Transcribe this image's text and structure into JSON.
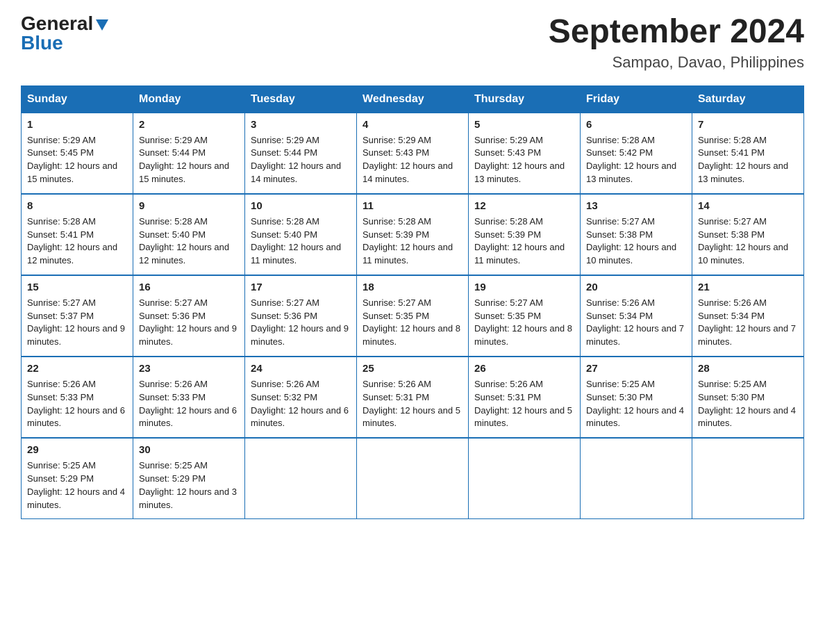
{
  "header": {
    "logo_general": "General",
    "logo_blue": "Blue",
    "month_year": "September 2024",
    "location": "Sampao, Davao, Philippines"
  },
  "days_of_week": [
    "Sunday",
    "Monday",
    "Tuesday",
    "Wednesday",
    "Thursday",
    "Friday",
    "Saturday"
  ],
  "weeks": [
    [
      {
        "day": "1",
        "sunrise": "Sunrise: 5:29 AM",
        "sunset": "Sunset: 5:45 PM",
        "daylight": "Daylight: 12 hours and 15 minutes."
      },
      {
        "day": "2",
        "sunrise": "Sunrise: 5:29 AM",
        "sunset": "Sunset: 5:44 PM",
        "daylight": "Daylight: 12 hours and 15 minutes."
      },
      {
        "day": "3",
        "sunrise": "Sunrise: 5:29 AM",
        "sunset": "Sunset: 5:44 PM",
        "daylight": "Daylight: 12 hours and 14 minutes."
      },
      {
        "day": "4",
        "sunrise": "Sunrise: 5:29 AM",
        "sunset": "Sunset: 5:43 PM",
        "daylight": "Daylight: 12 hours and 14 minutes."
      },
      {
        "day": "5",
        "sunrise": "Sunrise: 5:29 AM",
        "sunset": "Sunset: 5:43 PM",
        "daylight": "Daylight: 12 hours and 13 minutes."
      },
      {
        "day": "6",
        "sunrise": "Sunrise: 5:28 AM",
        "sunset": "Sunset: 5:42 PM",
        "daylight": "Daylight: 12 hours and 13 minutes."
      },
      {
        "day": "7",
        "sunrise": "Sunrise: 5:28 AM",
        "sunset": "Sunset: 5:41 PM",
        "daylight": "Daylight: 12 hours and 13 minutes."
      }
    ],
    [
      {
        "day": "8",
        "sunrise": "Sunrise: 5:28 AM",
        "sunset": "Sunset: 5:41 PM",
        "daylight": "Daylight: 12 hours and 12 minutes."
      },
      {
        "day": "9",
        "sunrise": "Sunrise: 5:28 AM",
        "sunset": "Sunset: 5:40 PM",
        "daylight": "Daylight: 12 hours and 12 minutes."
      },
      {
        "day": "10",
        "sunrise": "Sunrise: 5:28 AM",
        "sunset": "Sunset: 5:40 PM",
        "daylight": "Daylight: 12 hours and 11 minutes."
      },
      {
        "day": "11",
        "sunrise": "Sunrise: 5:28 AM",
        "sunset": "Sunset: 5:39 PM",
        "daylight": "Daylight: 12 hours and 11 minutes."
      },
      {
        "day": "12",
        "sunrise": "Sunrise: 5:28 AM",
        "sunset": "Sunset: 5:39 PM",
        "daylight": "Daylight: 12 hours and 11 minutes."
      },
      {
        "day": "13",
        "sunrise": "Sunrise: 5:27 AM",
        "sunset": "Sunset: 5:38 PM",
        "daylight": "Daylight: 12 hours and 10 minutes."
      },
      {
        "day": "14",
        "sunrise": "Sunrise: 5:27 AM",
        "sunset": "Sunset: 5:38 PM",
        "daylight": "Daylight: 12 hours and 10 minutes."
      }
    ],
    [
      {
        "day": "15",
        "sunrise": "Sunrise: 5:27 AM",
        "sunset": "Sunset: 5:37 PM",
        "daylight": "Daylight: 12 hours and 9 minutes."
      },
      {
        "day": "16",
        "sunrise": "Sunrise: 5:27 AM",
        "sunset": "Sunset: 5:36 PM",
        "daylight": "Daylight: 12 hours and 9 minutes."
      },
      {
        "day": "17",
        "sunrise": "Sunrise: 5:27 AM",
        "sunset": "Sunset: 5:36 PM",
        "daylight": "Daylight: 12 hours and 9 minutes."
      },
      {
        "day": "18",
        "sunrise": "Sunrise: 5:27 AM",
        "sunset": "Sunset: 5:35 PM",
        "daylight": "Daylight: 12 hours and 8 minutes."
      },
      {
        "day": "19",
        "sunrise": "Sunrise: 5:27 AM",
        "sunset": "Sunset: 5:35 PM",
        "daylight": "Daylight: 12 hours and 8 minutes."
      },
      {
        "day": "20",
        "sunrise": "Sunrise: 5:26 AM",
        "sunset": "Sunset: 5:34 PM",
        "daylight": "Daylight: 12 hours and 7 minutes."
      },
      {
        "day": "21",
        "sunrise": "Sunrise: 5:26 AM",
        "sunset": "Sunset: 5:34 PM",
        "daylight": "Daylight: 12 hours and 7 minutes."
      }
    ],
    [
      {
        "day": "22",
        "sunrise": "Sunrise: 5:26 AM",
        "sunset": "Sunset: 5:33 PM",
        "daylight": "Daylight: 12 hours and 6 minutes."
      },
      {
        "day": "23",
        "sunrise": "Sunrise: 5:26 AM",
        "sunset": "Sunset: 5:33 PM",
        "daylight": "Daylight: 12 hours and 6 minutes."
      },
      {
        "day": "24",
        "sunrise": "Sunrise: 5:26 AM",
        "sunset": "Sunset: 5:32 PM",
        "daylight": "Daylight: 12 hours and 6 minutes."
      },
      {
        "day": "25",
        "sunrise": "Sunrise: 5:26 AM",
        "sunset": "Sunset: 5:31 PM",
        "daylight": "Daylight: 12 hours and 5 minutes."
      },
      {
        "day": "26",
        "sunrise": "Sunrise: 5:26 AM",
        "sunset": "Sunset: 5:31 PM",
        "daylight": "Daylight: 12 hours and 5 minutes."
      },
      {
        "day": "27",
        "sunrise": "Sunrise: 5:25 AM",
        "sunset": "Sunset: 5:30 PM",
        "daylight": "Daylight: 12 hours and 4 minutes."
      },
      {
        "day": "28",
        "sunrise": "Sunrise: 5:25 AM",
        "sunset": "Sunset: 5:30 PM",
        "daylight": "Daylight: 12 hours and 4 minutes."
      }
    ],
    [
      {
        "day": "29",
        "sunrise": "Sunrise: 5:25 AM",
        "sunset": "Sunset: 5:29 PM",
        "daylight": "Daylight: 12 hours and 4 minutes."
      },
      {
        "day": "30",
        "sunrise": "Sunrise: 5:25 AM",
        "sunset": "Sunset: 5:29 PM",
        "daylight": "Daylight: 12 hours and 3 minutes."
      },
      null,
      null,
      null,
      null,
      null
    ]
  ]
}
